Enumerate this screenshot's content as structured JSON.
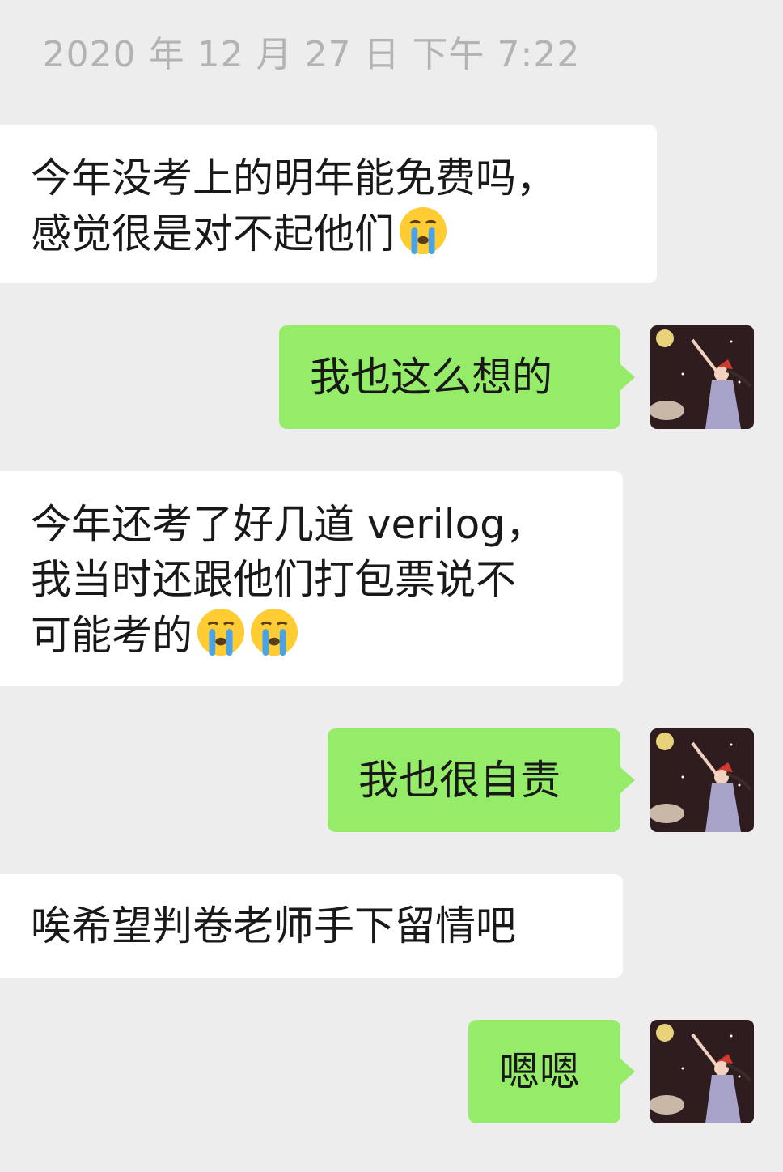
{
  "timestamp": "2020 年 12 月 27 日  下午 7:22",
  "messages": [
    {
      "side": "in",
      "lines": [
        "今年没考上的明年能免费吗，",
        "感觉很是对不起他们"
      ],
      "emoji": [
        "loudly-crying-face"
      ]
    },
    {
      "side": "out",
      "lines": [
        "我也这么想的"
      ]
    },
    {
      "side": "in",
      "lines": [
        "今年还考了好几道 verilog，",
        "我当时还跟他们打包票说不",
        "可能考的"
      ],
      "emoji": [
        "loudly-crying-face",
        "loudly-crying-face"
      ]
    },
    {
      "side": "out",
      "lines": [
        "我也很自责"
      ]
    },
    {
      "side": "in",
      "lines": [
        "唉希望判卷老师手下留情吧"
      ]
    },
    {
      "side": "out",
      "lines": [
        "嗯嗯"
      ]
    }
  ],
  "colors": {
    "background": "#ededed",
    "incoming_bubble": "#ffffff",
    "outgoing_bubble": "#95ec69",
    "timestamp": "#b3b3b3"
  }
}
